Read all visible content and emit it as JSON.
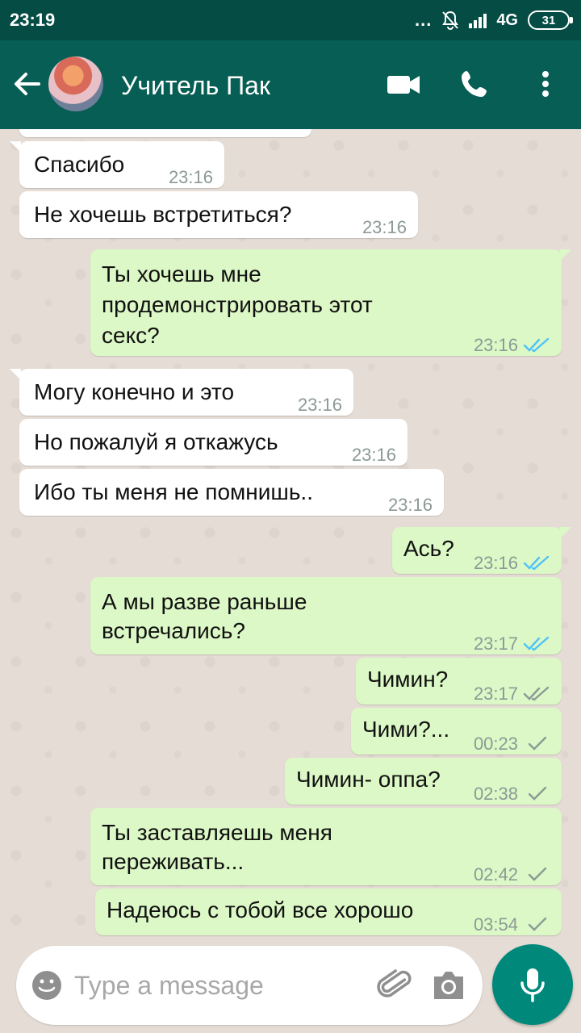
{
  "status_bar": {
    "time": "23:19",
    "dots": "...",
    "network": "4G",
    "battery": "31"
  },
  "header": {
    "contact_name": "Учитель Пак"
  },
  "messages": [
    {
      "dir": "in",
      "lines": [
        "Спасибо"
      ],
      "time": "23:16"
    },
    {
      "dir": "in",
      "lines": [
        "Не хочешь встретиться?"
      ],
      "time": "23:16"
    },
    {
      "dir": "out",
      "lines": [
        "Ты хочешь мне",
        "продемонстрировать этот",
        "секс?"
      ],
      "time": "23:16",
      "status": "read"
    },
    {
      "dir": "in",
      "lines": [
        "Могу конечно и это"
      ],
      "time": "23:16"
    },
    {
      "dir": "in",
      "lines": [
        "Но пожалуй я откажусь"
      ],
      "time": "23:16"
    },
    {
      "dir": "in",
      "lines": [
        "Ибо ты меня не помнишь.."
      ],
      "time": "23:16"
    },
    {
      "dir": "out",
      "lines": [
        "Ась?"
      ],
      "time": "23:16",
      "status": "read"
    },
    {
      "dir": "out",
      "lines": [
        "А мы разве раньше",
        "встречались?"
      ],
      "time": "23:17",
      "status": "read"
    },
    {
      "dir": "out",
      "lines": [
        "Чимин?"
      ],
      "time": "23:17",
      "status": "delivered"
    },
    {
      "dir": "out",
      "lines": [
        "Чими?..."
      ],
      "time": "00:23",
      "status": "sent"
    },
    {
      "dir": "out",
      "lines": [
        "Чимин- оппа?"
      ],
      "time": "02:38",
      "status": "sent"
    },
    {
      "dir": "out",
      "lines": [
        "Ты заставляешь меня",
        "переживать..."
      ],
      "time": "02:42",
      "status": "sent"
    },
    {
      "dir": "out",
      "lines": [
        "Надеюсь с тобой все хорошо"
      ],
      "time": "03:54",
      "status": "sent"
    }
  ],
  "composer": {
    "placeholder": "Type a message"
  },
  "colors": {
    "header": "#075e54",
    "status_bar": "#054d44",
    "outgoing": "#dcf8c6",
    "incoming": "#ffffff",
    "read_tick": "#4fc3f7",
    "mic": "#00897b"
  }
}
